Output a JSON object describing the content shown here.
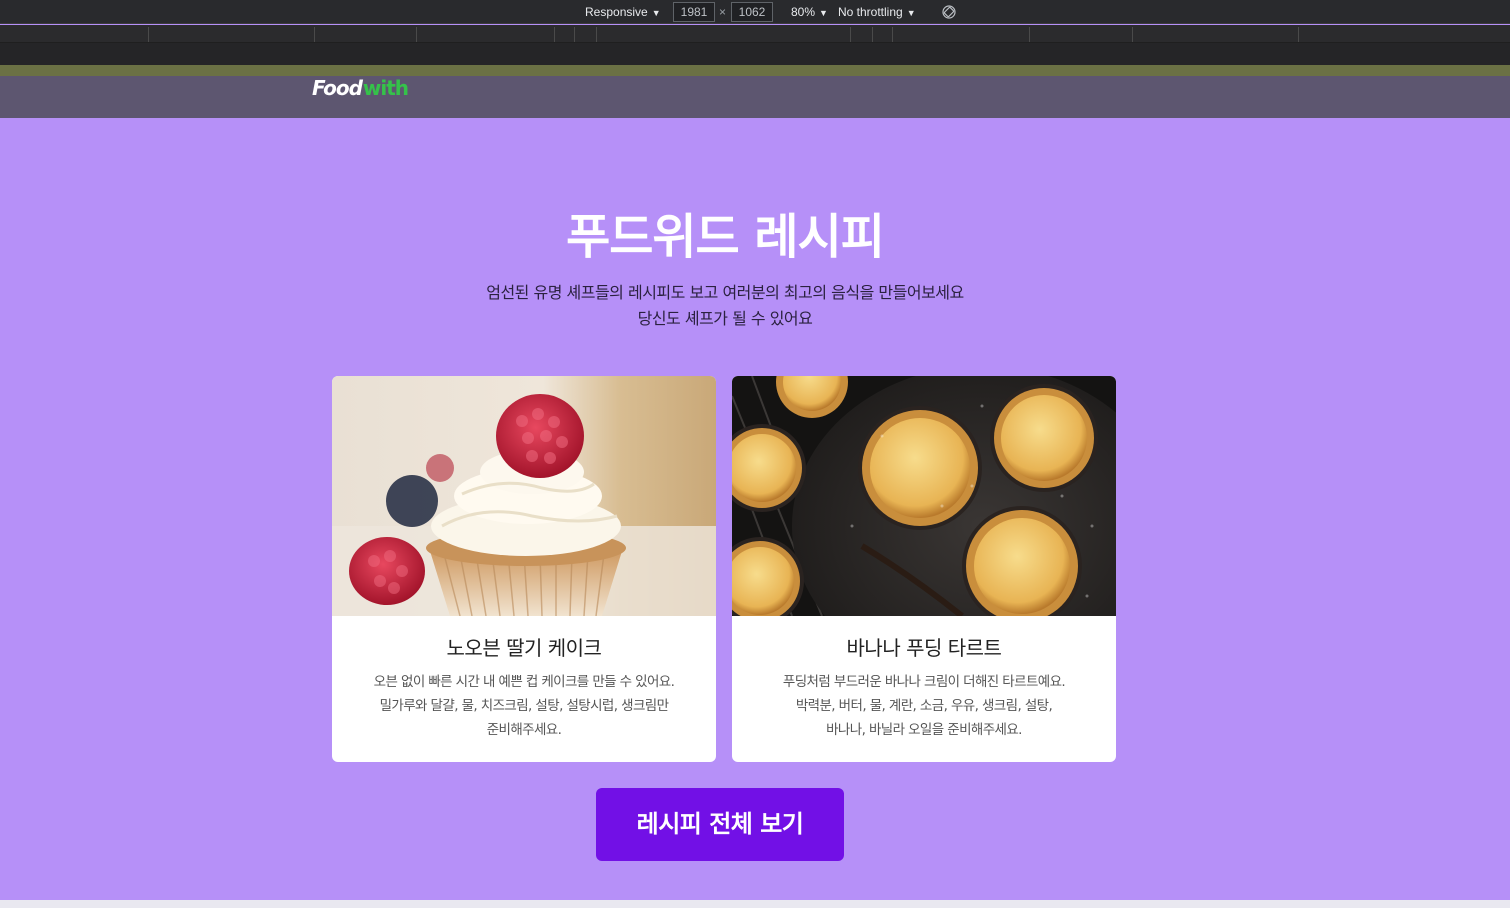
{
  "devtools": {
    "device_mode": "Responsive",
    "width": "1981",
    "times": "×",
    "height": "1062",
    "zoom": "80%",
    "throttling": "No throttling"
  },
  "site": {
    "logo_food": "Food",
    "logo_with": "with"
  },
  "hero": {
    "title": "푸드위드 레시피",
    "subtitle_line1": "엄선된 유명 셰프들의 레시피도 보고 여러분의 최고의 음식을 만들어보세요",
    "subtitle_line2": "당신도 셰프가 될 수 있어요"
  },
  "cards": [
    {
      "title": "노오븐 딸기 케이크",
      "desc_line1": "오븐 없이 빠른 시간 내 예쁜 컵 케이크를 만들 수 있어요.",
      "desc_line2": "밀가루와 달걀, 물, 치즈크림, 설탕, 설탕시럽, 생크림만",
      "desc_line3": "준비해주세요."
    },
    {
      "title": "바나나 푸딩 타르트",
      "desc_line1": "푸딩처럼 부드러운 바나나 크림이 더해진 타르트예요.",
      "desc_line2": "박력분, 버터, 물, 계란, 소금, 우유, 생크림, 설탕,",
      "desc_line3": "바나나, 바닐라 오일을 준비해주세요."
    }
  ],
  "cta": {
    "label": "레시피 전체 보기"
  },
  "colors": {
    "page_bg": "#b690f8",
    "button": "#7210e6",
    "logo_accent": "#35c24a"
  },
  "icons": {
    "rotate": "rotate-icon"
  }
}
